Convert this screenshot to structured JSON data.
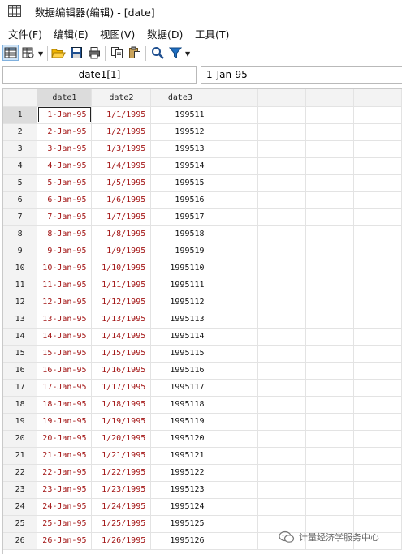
{
  "window": {
    "title": "数据编辑器(编辑) - [date]"
  },
  "menu": {
    "items": [
      {
        "label": "文件(F)"
      },
      {
        "label": "编辑(E)"
      },
      {
        "label": "视图(V)"
      },
      {
        "label": "数据(D)"
      },
      {
        "label": "工具(T)"
      }
    ]
  },
  "toolbar": {
    "icons": [
      "edit-mode-icon",
      "browse-mode-icon",
      "open-icon",
      "save-icon",
      "print-icon",
      "copy-icon",
      "paste-icon",
      "find-icon",
      "filter-icon"
    ]
  },
  "refbar": {
    "cell_name": "date1[1]",
    "cell_value": "1-Jan-95"
  },
  "grid": {
    "columns": [
      "date1",
      "date2",
      "date3"
    ],
    "rows": [
      {
        "n": "1",
        "date1": "1-Jan-95",
        "date2": "1/1/1995",
        "date3": "199511"
      },
      {
        "n": "2",
        "date1": "2-Jan-95",
        "date2": "1/2/1995",
        "date3": "199512"
      },
      {
        "n": "3",
        "date1": "3-Jan-95",
        "date2": "1/3/1995",
        "date3": "199513"
      },
      {
        "n": "4",
        "date1": "4-Jan-95",
        "date2": "1/4/1995",
        "date3": "199514"
      },
      {
        "n": "5",
        "date1": "5-Jan-95",
        "date2": "1/5/1995",
        "date3": "199515"
      },
      {
        "n": "6",
        "date1": "6-Jan-95",
        "date2": "1/6/1995",
        "date3": "199516"
      },
      {
        "n": "7",
        "date1": "7-Jan-95",
        "date2": "1/7/1995",
        "date3": "199517"
      },
      {
        "n": "8",
        "date1": "8-Jan-95",
        "date2": "1/8/1995",
        "date3": "199518"
      },
      {
        "n": "9",
        "date1": "9-Jan-95",
        "date2": "1/9/1995",
        "date3": "199519"
      },
      {
        "n": "10",
        "date1": "10-Jan-95",
        "date2": "1/10/1995",
        "date3": "1995110"
      },
      {
        "n": "11",
        "date1": "11-Jan-95",
        "date2": "1/11/1995",
        "date3": "1995111"
      },
      {
        "n": "12",
        "date1": "12-Jan-95",
        "date2": "1/12/1995",
        "date3": "1995112"
      },
      {
        "n": "13",
        "date1": "13-Jan-95",
        "date2": "1/13/1995",
        "date3": "1995113"
      },
      {
        "n": "14",
        "date1": "14-Jan-95",
        "date2": "1/14/1995",
        "date3": "1995114"
      },
      {
        "n": "15",
        "date1": "15-Jan-95",
        "date2": "1/15/1995",
        "date3": "1995115"
      },
      {
        "n": "16",
        "date1": "16-Jan-95",
        "date2": "1/16/1995",
        "date3": "1995116"
      },
      {
        "n": "17",
        "date1": "17-Jan-95",
        "date2": "1/17/1995",
        "date3": "1995117"
      },
      {
        "n": "18",
        "date1": "18-Jan-95",
        "date2": "1/18/1995",
        "date3": "1995118"
      },
      {
        "n": "19",
        "date1": "19-Jan-95",
        "date2": "1/19/1995",
        "date3": "1995119"
      },
      {
        "n": "20",
        "date1": "20-Jan-95",
        "date2": "1/20/1995",
        "date3": "1995120"
      },
      {
        "n": "21",
        "date1": "21-Jan-95",
        "date2": "1/21/1995",
        "date3": "1995121"
      },
      {
        "n": "22",
        "date1": "22-Jan-95",
        "date2": "1/22/1995",
        "date3": "1995122"
      },
      {
        "n": "23",
        "date1": "23-Jan-95",
        "date2": "1/23/1995",
        "date3": "1995123"
      },
      {
        "n": "24",
        "date1": "24-Jan-95",
        "date2": "1/24/1995",
        "date3": "1995124"
      },
      {
        "n": "25",
        "date1": "25-Jan-95",
        "date2": "1/25/1995",
        "date3": "1995125"
      },
      {
        "n": "26",
        "date1": "26-Jan-95",
        "date2": "1/26/1995",
        "date3": "1995126"
      }
    ]
  },
  "watermark": {
    "text": "计量经济学服务中心"
  },
  "colors": {
    "date_text": "#a31515",
    "active_tool": "#cfe4f7",
    "open_folder": "#f0b400",
    "filter": "#1f6fc2"
  }
}
